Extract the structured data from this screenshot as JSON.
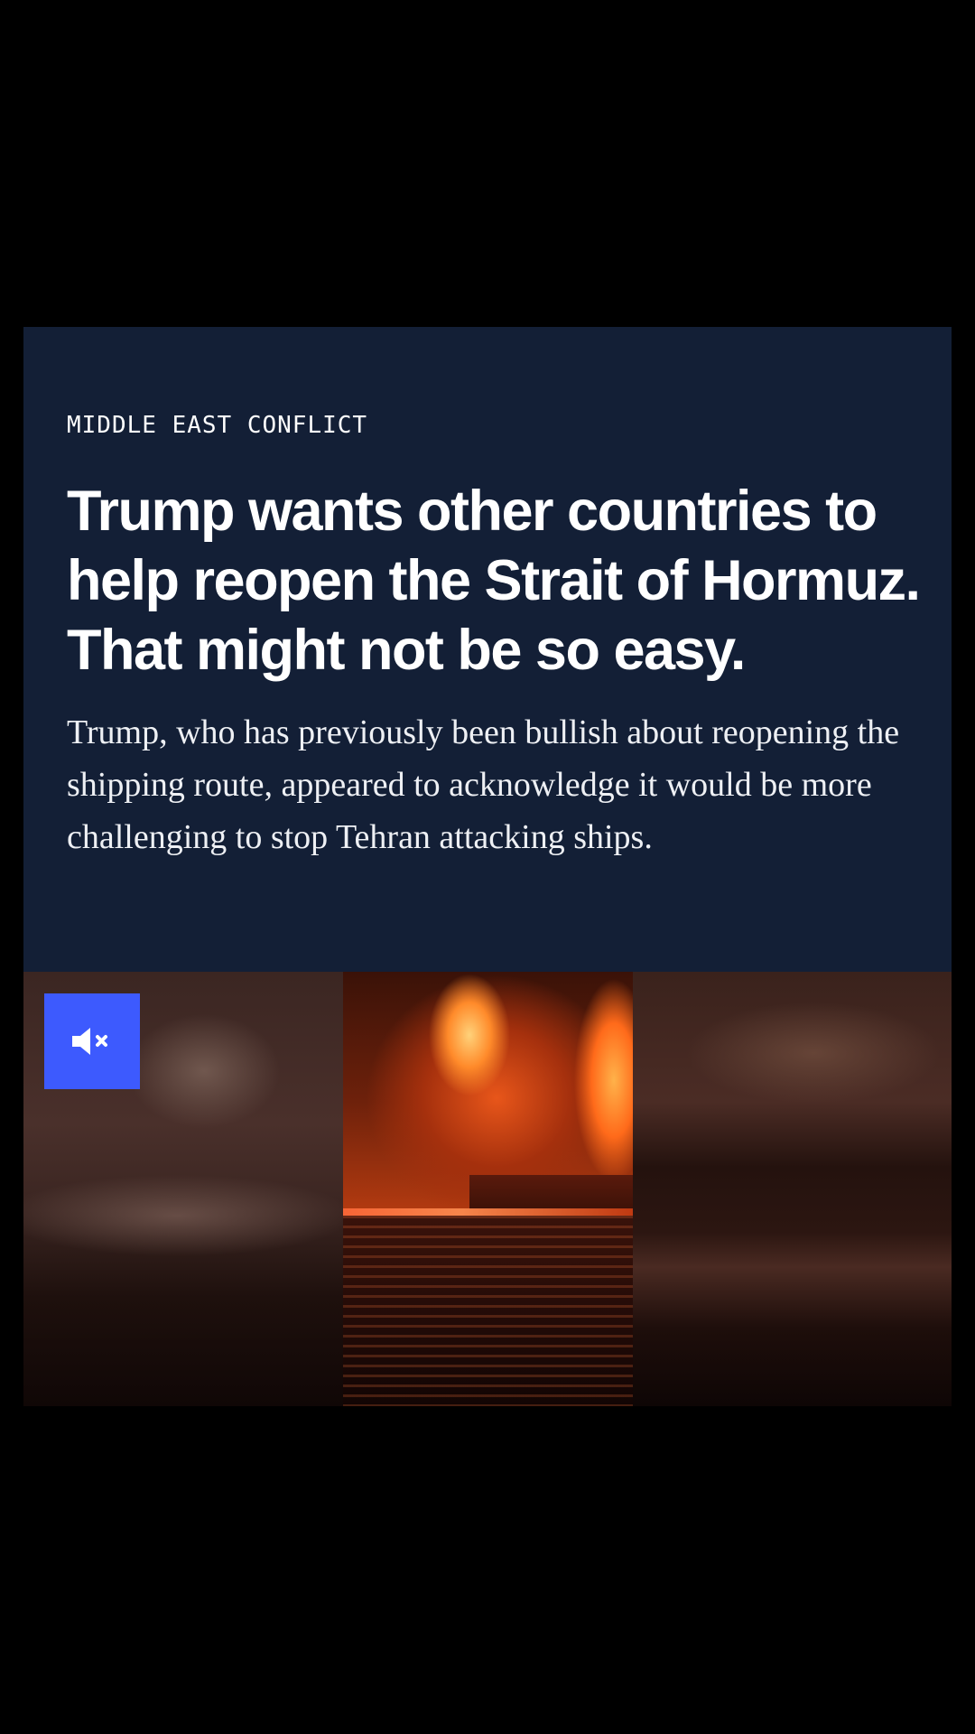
{
  "article": {
    "kicker": "MIDDLE EAST CONFLICT",
    "headline": "Trump wants other countries to help reopen the Strait of Hormuz. That might not be so easy.",
    "dek": "Trump, who has previously been bullish about reopening the shipping route, appeared to acknowledge it would be more challenging to stop Tehran attacking ships."
  },
  "video": {
    "mute_icon": "speaker-muted-icon",
    "muted": true
  },
  "colors": {
    "background": "#000000",
    "card": "#131f36",
    "mute_button": "#3d5afe",
    "text": "#ffffff"
  }
}
